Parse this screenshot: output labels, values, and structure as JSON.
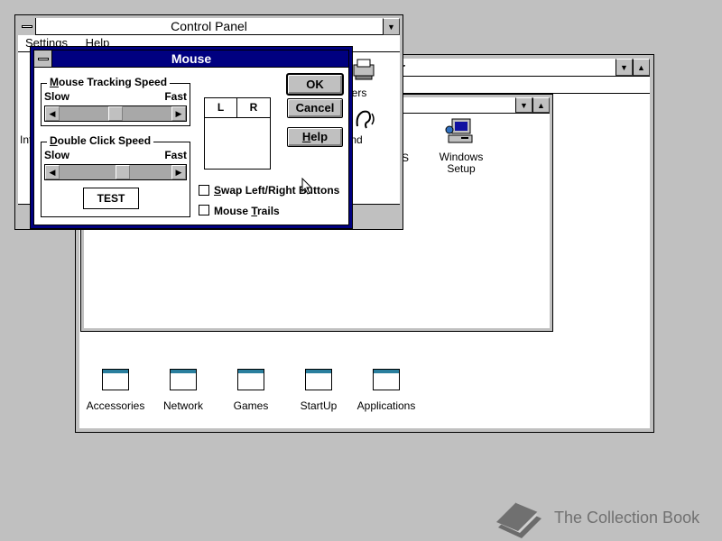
{
  "control_panel": {
    "title": "Control Panel",
    "menu": [
      "Settings",
      "Help"
    ],
    "partial_labels": {
      "printers": "Printers",
      "sound": "Sound",
      "international": "Int"
    }
  },
  "program_manager": {
    "title_partial": "r",
    "inner_window": {
      "icon_label": "Windows Setup",
      "partial_label": "S"
    },
    "groups": [
      "Accessories",
      "Network",
      "Games",
      "StartUp",
      "Applications"
    ]
  },
  "mouse_dialog": {
    "title": "Mouse",
    "tracking": {
      "label_prefix": "M",
      "label_rest": "ouse Tracking Speed",
      "slow": "Slow",
      "fast": "Fast",
      "value": 0.5
    },
    "double_click": {
      "label_prefix": "D",
      "label_rest": "ouble Click Speed",
      "slow": "Slow",
      "fast": "Fast",
      "value": 0.55
    },
    "test_label": "TEST",
    "mouse_buttons": {
      "left": "L",
      "right": "R"
    },
    "swap": {
      "prefix": "S",
      "rest": "wap Left/Right Buttons",
      "checked": false
    },
    "trails": {
      "prefix": "Mouse ",
      "key": "T",
      "rest": "rails",
      "checked": false
    },
    "ok": "OK",
    "cancel": "Cancel",
    "help_prefix": "H",
    "help_rest": "elp"
  },
  "watermark": {
    "text": "The Collection Book"
  }
}
